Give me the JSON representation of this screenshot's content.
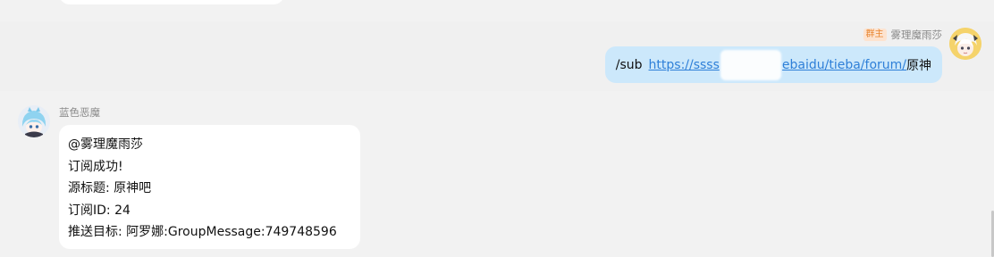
{
  "self_message": {
    "role_badge": "群主",
    "sender": "雾理魔雨莎",
    "command": "/sub",
    "link_start": "https://ssss",
    "link_end": "ebaidu/tieba/forum/",
    "suffix": "原神"
  },
  "bot_message": {
    "sender": "蓝色恶魔",
    "lines": [
      "@雾理魔雨莎",
      "订阅成功!",
      "源标题: 原神吧",
      "订阅ID: 24",
      "推送目标: 阿罗娜:GroupMessage:749748596"
    ]
  },
  "colors": {
    "self_bubble": "#cce8fb",
    "other_bubble": "#ffffff",
    "link": "#2e7fd8",
    "badge_bg": "#fde3cf",
    "badge_text": "#e8842e"
  }
}
